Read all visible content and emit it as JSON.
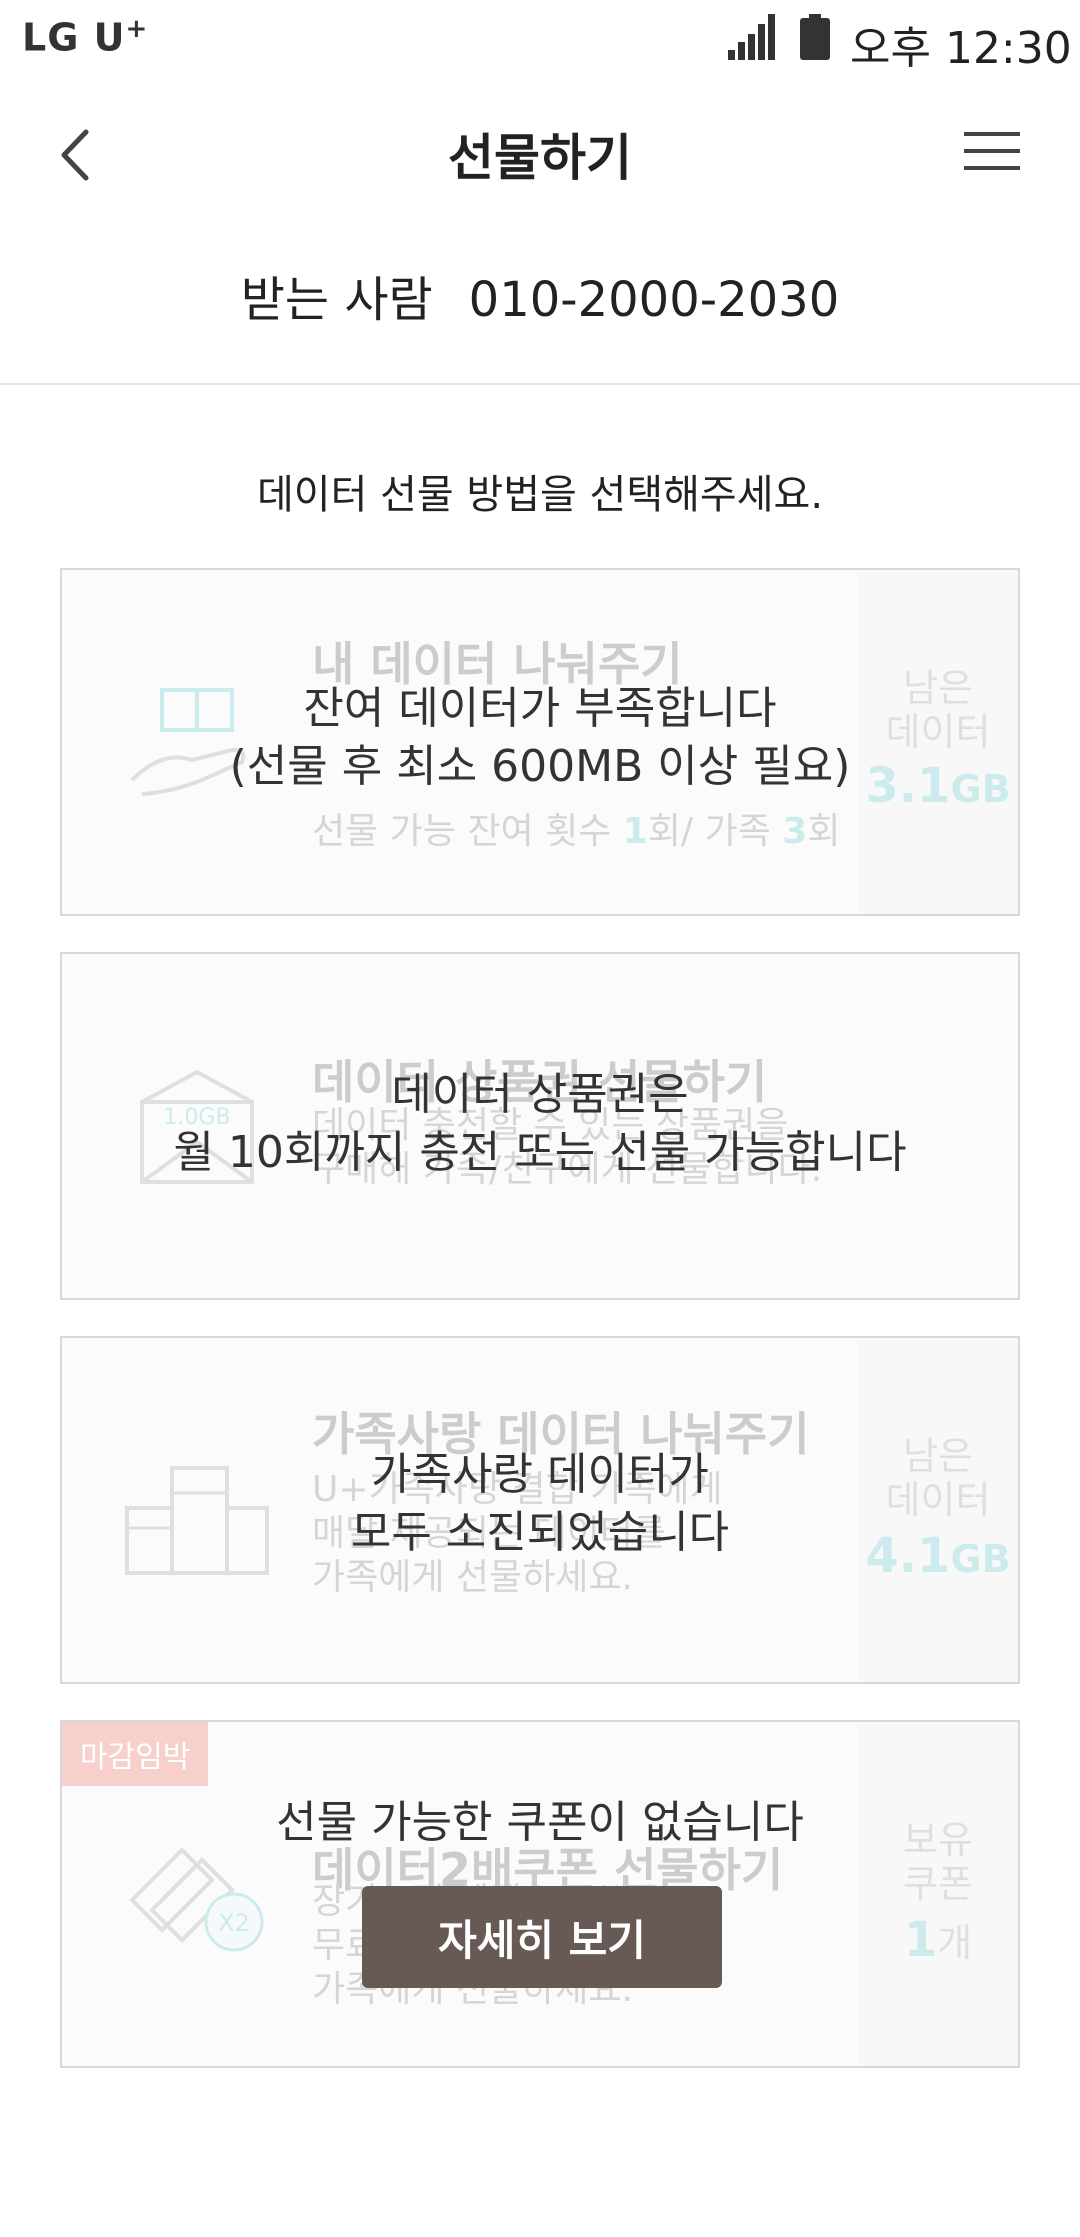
{
  "status_bar": {
    "carrier": "LG U",
    "carrier_sup": "+",
    "time": "오후 12:30"
  },
  "header": {
    "title": "선물하기",
    "back_icon": "chevron-left-icon",
    "menu_icon": "hamburger-menu-icon"
  },
  "recipient": {
    "label": "받는 사람",
    "number": "010-2000-2030"
  },
  "instruction": "데이터 선물 방법을 선택해주세요.",
  "cards": [
    {
      "title": "내 데이터 나눠주기",
      "overlay_line1": "잔여 데이터가 부족합니다",
      "overlay_line2": "(선물 후 최소 600MB 이상 필요)",
      "remaining_prefix": "선물 가능 잔여 횟수 ",
      "remaining_count": "1",
      "remaining_mid": "회/ 가족 ",
      "family_count": "3",
      "remaining_suffix": "회",
      "side_label_1": "남은",
      "side_label_2": "데이터",
      "side_value": "3.1",
      "side_unit": "GB"
    },
    {
      "title": "데이터 상품권 선물하기",
      "desc_line1": "데이터 충전할 수 있는 상품권을",
      "desc_line2": "구매해 가족/친구에게 선물합니다.",
      "voucher_label": "1.0GB",
      "overlay_line1": "데이터 상품권은",
      "overlay_line2": "월 10회까지 충전 또는 선물 가능합니다"
    },
    {
      "title": "가족사랑 데이터 나눠주기",
      "desc_line1": "U+가족사랑 결합 가족에게",
      "desc_line2": "매달 제공되는 데이터를",
      "desc_line3": "가족에게 선물하세요.",
      "overlay_line1": "가족사랑 데이터가",
      "overlay_line2": "모두 소진되었습니다",
      "side_label_1": "남은",
      "side_label_2": "데이터",
      "side_value": "4.1",
      "side_unit": "GB"
    },
    {
      "badge": "마감임박",
      "title": "데이터2배쿠폰 선물하기",
      "desc_line1": "장기고객 혜택으로 받은",
      "desc_line2": "무료 데이터 쿠폰을",
      "desc_line3": "가족에게 선물하세요.",
      "coupon_label": "X2",
      "overlay_line1": "선물 가능한 쿠폰이 없습니다",
      "button_label": "자세히 보기",
      "side_label_1": "보유",
      "side_label_2": "쿠폰",
      "side_value": "1",
      "side_unit": "개"
    }
  ],
  "colors": {
    "accent": "#57c4c8",
    "button": "#675a54",
    "badge": "#f7d0cc"
  }
}
